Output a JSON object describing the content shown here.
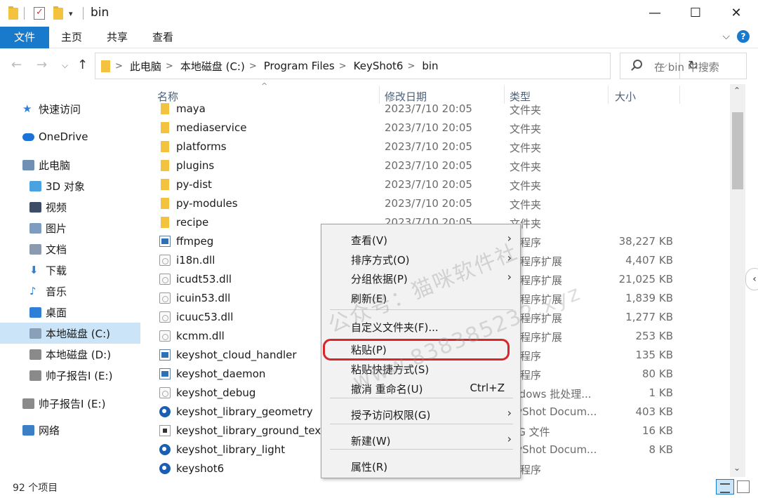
{
  "window": {
    "title": "bin",
    "controls": {
      "minimize": "—",
      "maximize": "☐",
      "close": "✕"
    }
  },
  "ribbon": {
    "tabs": [
      "文件",
      "主页",
      "共享",
      "查看"
    ]
  },
  "address": {
    "crumbs": [
      "此电脑",
      "本地磁盘 (C:)",
      "Program Files",
      "KeyShot6",
      "bin"
    ],
    "search_placeholder": "在 bin 中搜索"
  },
  "sidebar": {
    "items": [
      {
        "label": "快速访问",
        "icon": "star-icon",
        "color": "#2f7fd6"
      },
      {
        "label": "OneDrive",
        "icon": "cloud-icon",
        "color": "#1a73d9"
      },
      {
        "label": "此电脑",
        "icon": "computer-icon",
        "color": "#6f8fb5"
      },
      {
        "label": "3D 对象",
        "icon": "cube-icon",
        "color": "#4aa3e0"
      },
      {
        "label": "视频",
        "icon": "film-icon",
        "color": "#3d4d66"
      },
      {
        "label": "图片",
        "icon": "picture-icon",
        "color": "#7d9cc0"
      },
      {
        "label": "文档",
        "icon": "document-icon",
        "color": "#8a9bb0"
      },
      {
        "label": "下载",
        "icon": "download-icon",
        "color": "#2f7fd6"
      },
      {
        "label": "音乐",
        "icon": "music-icon",
        "color": "#2f7fd6"
      },
      {
        "label": "桌面",
        "icon": "desktop-icon",
        "color": "#2f7fd6"
      },
      {
        "label": "本地磁盘 (C:)",
        "icon": "drive-windows-icon",
        "color": "#8aa0b8"
      },
      {
        "label": "本地磁盘 (D:)",
        "icon": "drive-icon",
        "color": "#8a8a8a"
      },
      {
        "label": "帅子报告I (E:)",
        "icon": "usb-drive-icon",
        "color": "#8a8a8a"
      },
      {
        "label": "帅子报告I (E:)",
        "icon": "usb-drive-icon",
        "color": "#8a8a8a"
      },
      {
        "label": "网络",
        "icon": "network-icon",
        "color": "#3d7fc4"
      }
    ]
  },
  "columns": {
    "name": "名称",
    "date": "修改日期",
    "type": "类型",
    "size": "大小"
  },
  "files": [
    {
      "name": "maya",
      "date": "2023/7/10 20:05",
      "type": "文件夹",
      "size": "",
      "icon": "folder"
    },
    {
      "name": "mediaservice",
      "date": "2023/7/10 20:05",
      "type": "文件夹",
      "size": "",
      "icon": "folder"
    },
    {
      "name": "platforms",
      "date": "2023/7/10 20:05",
      "type": "文件夹",
      "size": "",
      "icon": "folder"
    },
    {
      "name": "plugins",
      "date": "2023/7/10 20:05",
      "type": "文件夹",
      "size": "",
      "icon": "folder"
    },
    {
      "name": "py-dist",
      "date": "2023/7/10 20:05",
      "type": "文件夹",
      "size": "",
      "icon": "folder"
    },
    {
      "name": "py-modules",
      "date": "2023/7/10 20:05",
      "type": "文件夹",
      "size": "",
      "icon": "folder"
    },
    {
      "name": "recipe",
      "date": "2023/7/10 20:05",
      "type": "文件夹",
      "size": "",
      "icon": "folder"
    },
    {
      "name": "ffmpeg",
      "date": "",
      "type": "用程序",
      "size": "38,227 KB",
      "icon": "exe"
    },
    {
      "name": "i18n.dll",
      "date": "",
      "type": "用程序扩展",
      "size": "4,407 KB",
      "icon": "dll"
    },
    {
      "name": "icudt53.dll",
      "date": "",
      "type": "用程序扩展",
      "size": "21,025 KB",
      "icon": "dll"
    },
    {
      "name": "icuin53.dll",
      "date": "",
      "type": "用程序扩展",
      "size": "1,839 KB",
      "icon": "dll"
    },
    {
      "name": "icuuc53.dll",
      "date": "",
      "type": "用程序扩展",
      "size": "1,277 KB",
      "icon": "dll"
    },
    {
      "name": "kcmm.dll",
      "date": "",
      "type": "用程序扩展",
      "size": "253 KB",
      "icon": "dll"
    },
    {
      "name": "keyshot_cloud_handler",
      "date": "",
      "type": "用程序",
      "size": "135 KB",
      "icon": "exe"
    },
    {
      "name": "keyshot_daemon",
      "date": "",
      "type": "用程序",
      "size": "80 KB",
      "icon": "exe"
    },
    {
      "name": "keyshot_debug",
      "date": "",
      "type": "indows 批处理...",
      "size": "1 KB",
      "icon": "dll"
    },
    {
      "name": "keyshot_library_geometry",
      "date": "",
      "type": "eyShot Docum...",
      "size": "403 KB",
      "icon": "ks"
    },
    {
      "name": "keyshot_library_ground_text",
      "date": "",
      "type": "NG 文件",
      "size": "16 KB",
      "icon": "png"
    },
    {
      "name": "keyshot_library_light",
      "date": "",
      "type": "eyShot Docum...",
      "size": "8 KB",
      "icon": "ks"
    },
    {
      "name": "keyshot6",
      "date": "",
      "type": "用程序",
      "size": "",
      "icon": "ks"
    }
  ],
  "context_menu": {
    "items": [
      {
        "label": "查看(V)",
        "submenu": true
      },
      {
        "label": "排序方式(O)",
        "submenu": true
      },
      {
        "label": "分组依据(P)",
        "submenu": true
      },
      {
        "label": "刷新(E)",
        "submenu": false
      },
      {
        "label": "自定义文件夹(F)...",
        "submenu": false
      },
      {
        "label": "粘贴(P)",
        "submenu": false
      },
      {
        "label": "粘贴快捷方式(S)",
        "submenu": false
      },
      {
        "label": "撤消 重命名(U)",
        "shortcut": "Ctrl+Z",
        "submenu": false
      },
      {
        "label": "授予访问权限(G)",
        "submenu": true
      },
      {
        "label": "新建(W)",
        "submenu": true
      },
      {
        "label": "属性(R)",
        "submenu": false
      }
    ]
  },
  "watermark": {
    "line1": "公众号：猫咪软件社",
    "line2": "www.838385232.xyz"
  },
  "status": {
    "item_count": "92 个项目"
  },
  "colors": {
    "accent": "#1979ca",
    "selection": "#cce4f7",
    "highlight_ring": "#d9262b",
    "folder": "#f3c33f"
  }
}
